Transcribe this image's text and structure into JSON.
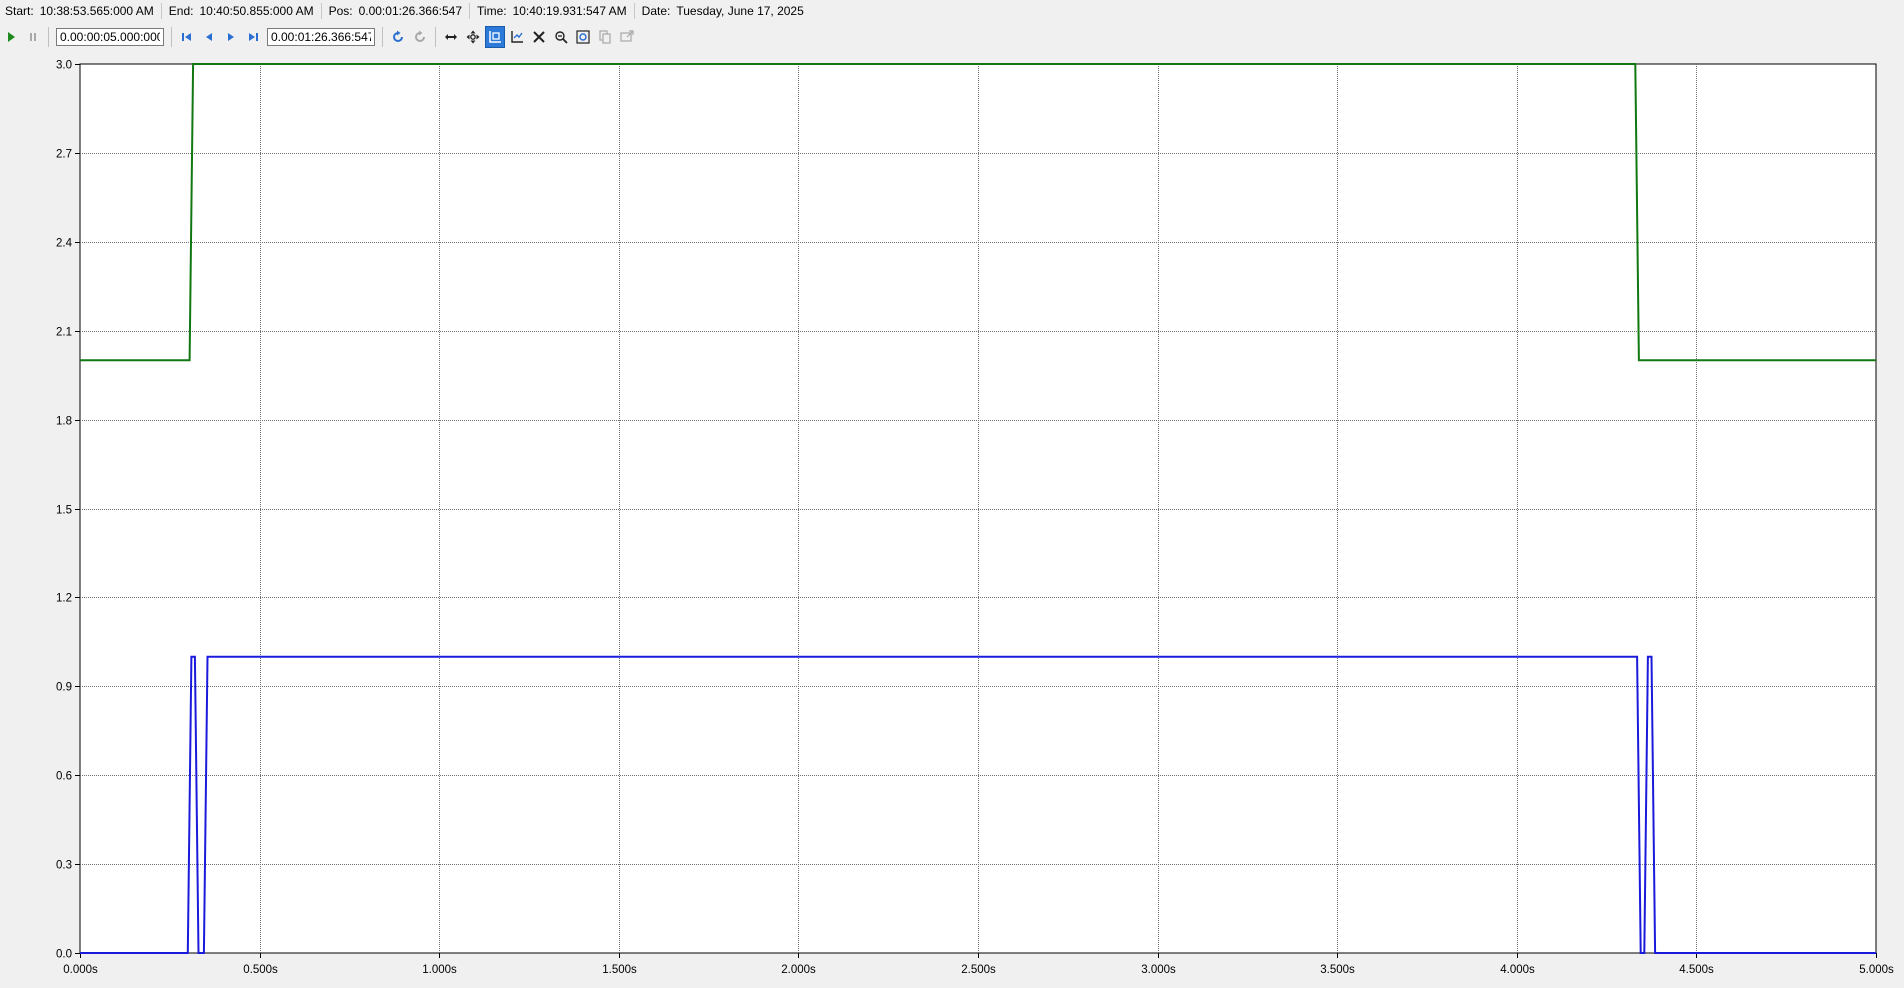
{
  "info_bar": {
    "start": {
      "label": "Start:",
      "value": "10:38:53.565:000 AM"
    },
    "end": {
      "label": "End:",
      "value": "10:40:50.855:000 AM"
    },
    "pos": {
      "label": "Pos:",
      "value": "0.00:01:26.366:547"
    },
    "time": {
      "label": "Time:",
      "value": "10:40:19.931:547 AM"
    },
    "date": {
      "label": "Date:",
      "value": "Tuesday, June 17, 2025"
    }
  },
  "toolbar": {
    "interval_value": "0.00:00:05.000:000",
    "position_value": "0.00:01:26.366:547",
    "icons": [
      "play-icon",
      "pause-icon",
      "first-icon",
      "previous-icon",
      "next-icon",
      "last-icon",
      "refresh-icon",
      "auto-refresh-icon",
      "fit-horizontal-icon",
      "pan-icon",
      "zoom-select-icon",
      "zoom-x-icon",
      "reset-zoom-icon",
      "zoom-out-icon",
      "zoom-fit-icon",
      "copy-icon",
      "export-icon"
    ]
  },
  "chart_data": {
    "type": "line",
    "x_unit": "s",
    "xlim": [
      0,
      5
    ],
    "ylim": [
      0,
      3
    ],
    "x_ticks": [
      "0.000s",
      "0.500s",
      "1.000s",
      "1.500s",
      "2.000s",
      "2.500s",
      "3.000s",
      "3.500s",
      "4.000s",
      "4.500s",
      "5.000s"
    ],
    "y_ticks": [
      "0.0",
      "0.3",
      "0.6",
      "0.9",
      "1.2",
      "1.5",
      "1.8",
      "2.1",
      "2.4",
      "2.7",
      "3.0"
    ],
    "grid": true,
    "series": [
      {
        "color": "#117711",
        "x": [
          0,
          0.305,
          0.315,
          4.33,
          4.34,
          5.0
        ],
        "y": [
          2,
          2,
          3,
          3,
          2,
          2
        ]
      },
      {
        "color": "#1a1add",
        "x": [
          0,
          0.3,
          0.31,
          0.32,
          0.33,
          0.345,
          0.355,
          0.365,
          4.335,
          4.345,
          4.355,
          4.365,
          4.375,
          4.385,
          4.395,
          5.0
        ],
        "y": [
          0,
          0,
          1,
          1,
          0,
          0,
          1,
          1,
          1,
          0,
          0,
          1,
          1,
          0,
          0,
          0
        ]
      }
    ]
  }
}
